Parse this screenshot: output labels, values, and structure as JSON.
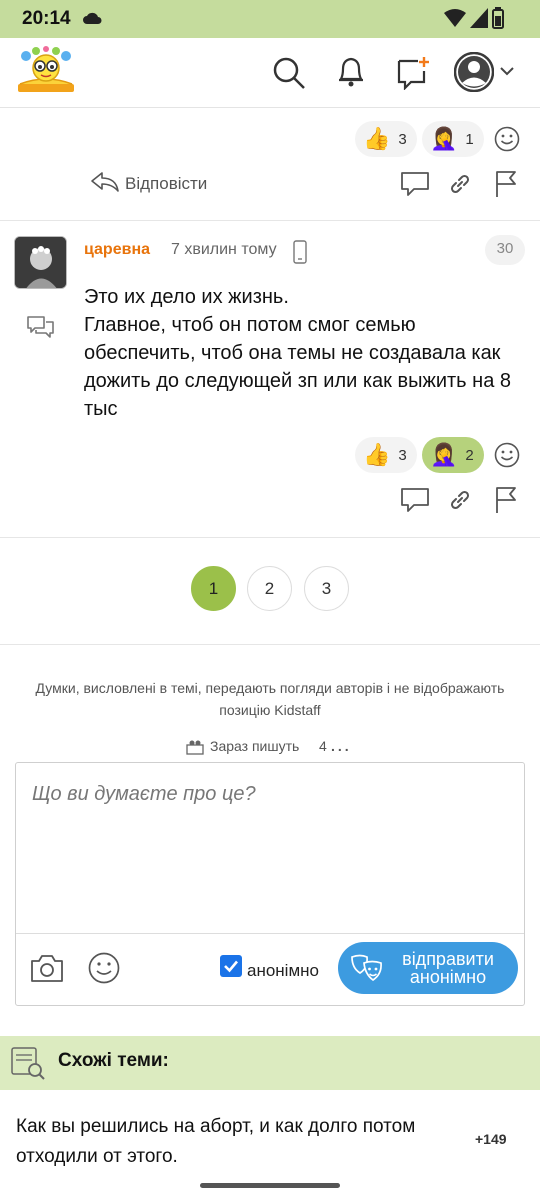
{
  "status_bar": {
    "time": "20:14"
  },
  "header": {
    "logo": "kidstaff-logo",
    "icons": [
      "search-icon",
      "bell-icon",
      "new-topic-icon",
      "avatar-icon",
      "chevron-down-icon"
    ]
  },
  "prev_comment": {
    "reactions": [
      {
        "emoji": "👍",
        "count": "3"
      },
      {
        "emoji": "🤦‍♀️",
        "count": "1"
      }
    ],
    "reply_label": "Відповісти"
  },
  "comment": {
    "author": "царевна",
    "time_ago": "7 хвилин тому",
    "post_number": "30",
    "text": "Это их дело их жизнь.\nГлавное, чтоб он потом смог семью обеспечить, чтоб она темы не создавала как дожить до следующей зп или как выжить на 8 тыс",
    "reactions": [
      {
        "emoji": "👍",
        "count": "3",
        "active": false
      },
      {
        "emoji": "🤦‍♀️",
        "count": "2",
        "active": true
      }
    ]
  },
  "pagination": {
    "pages": [
      "1",
      "2",
      "3"
    ],
    "current": "1"
  },
  "disclaimer": "Думки, висловлені в темі, передають погляди авторів і не відображають позицію Kidstaff",
  "writing_now": {
    "label": "Зараз пишуть",
    "count": "4"
  },
  "composer": {
    "placeholder": "Що ви думаєте про це?",
    "anon_label": "анонімно",
    "anon_checked": true,
    "send_label": "відправити анонімно"
  },
  "similar": {
    "title": "Схожі теми:",
    "topics": [
      {
        "title": "Как вы решились на аборт, и как долго потом отходили от этого.",
        "count": "+149"
      }
    ]
  },
  "colors": {
    "status_bar": "#c5dc9d",
    "accent_green": "#9bc04a",
    "author_orange": "#e8740c",
    "send_blue": "#3d9be0",
    "similar_bar": "#dcebc0"
  }
}
